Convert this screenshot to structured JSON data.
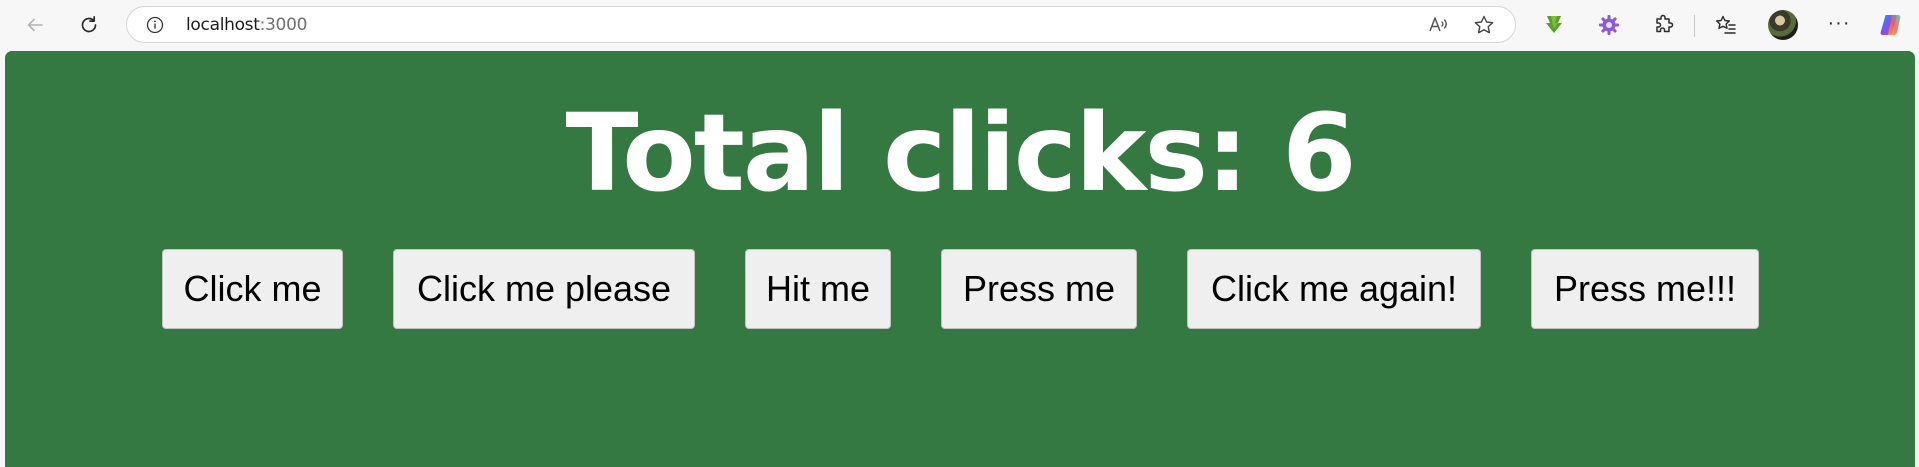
{
  "browser": {
    "url_host": "localhost",
    "url_port": ":3000",
    "icons": {
      "back": "back-arrow-icon",
      "refresh": "refresh-icon",
      "site_info": "info-icon",
      "read_aloud": "read-aloud-icon",
      "favorite": "star-icon",
      "download_ext": "green-download-extension-icon",
      "gear_ext": "purple-gear-extension-icon",
      "extensions": "puzzle-icon",
      "favorites": "favorites-list-icon",
      "profile": "avatar",
      "more": "more-icon",
      "copilot": "copilot-icon"
    },
    "more_label": "···"
  },
  "page": {
    "background_color": "#347942",
    "counter_text": "Total clicks: 6",
    "buttons": [
      {
        "label": "Click me"
      },
      {
        "label": "Click me please"
      },
      {
        "label": "Hit me"
      },
      {
        "label": "Press me"
      },
      {
        "label": "Click me again!"
      },
      {
        "label": "Press me!!!"
      }
    ]
  }
}
